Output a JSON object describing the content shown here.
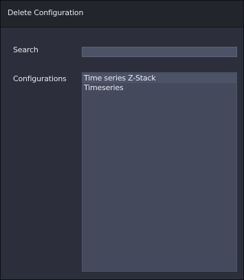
{
  "dialog": {
    "title": "Delete Configuration"
  },
  "search": {
    "label": "Search",
    "value": "",
    "placeholder": ""
  },
  "configurations": {
    "label": "Configurations",
    "items": [
      {
        "label": "Time series Z-Stack"
      },
      {
        "label": "Timeseries"
      }
    ]
  }
}
